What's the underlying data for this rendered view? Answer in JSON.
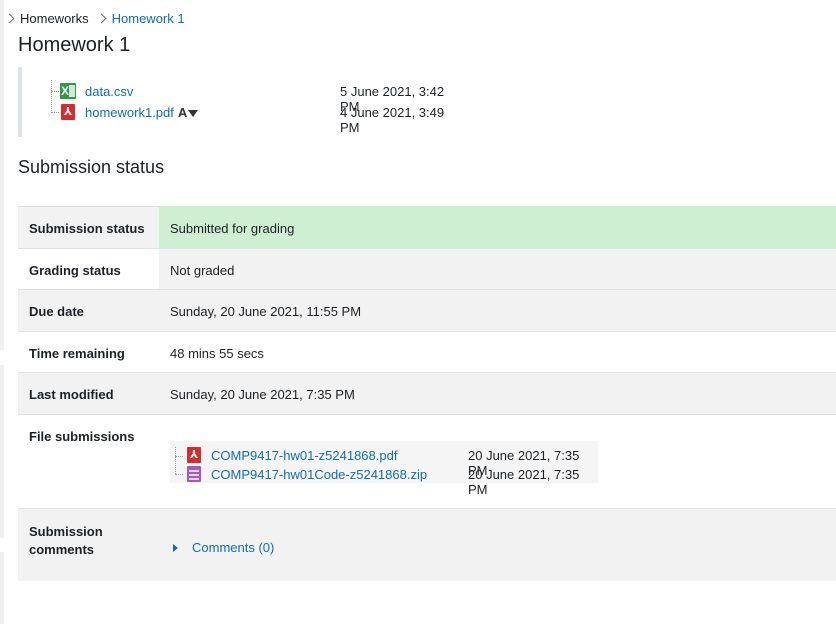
{
  "breadcrumb": {
    "items": [
      {
        "label": "Homeworks"
      },
      {
        "label": "Homework 1"
      }
    ]
  },
  "page": {
    "title": "Homework 1"
  },
  "intro_files": [
    {
      "name": "data.csv",
      "date": "5 June 2021, 3:42 PM",
      "icon": "csv-file-icon"
    },
    {
      "name": "homework1.pdf",
      "date": "4 June 2021, 3:49 PM",
      "icon": "pdf-file-icon",
      "a11y_letter": "A"
    }
  ],
  "submission": {
    "heading": "Submission status",
    "rows": [
      {
        "label": "Submission status",
        "value": "Submitted for grading",
        "status_color": "#cfefd3"
      },
      {
        "label": "Grading status",
        "value": "Not graded"
      },
      {
        "label": "Due date",
        "value": "Sunday, 20 June 2021, 11:55 PM"
      },
      {
        "label": "Time remaining",
        "value": "48 mins 55 secs"
      },
      {
        "label": "Last modified",
        "value": "Sunday, 20 June 2021, 7:35 PM"
      },
      {
        "label": "File submissions"
      },
      {
        "label": "Submission comments"
      }
    ],
    "files": [
      {
        "name": "COMP9417-hw01-z5241868.pdf",
        "date": "20 June 2021, 7:35 PM",
        "icon": "pdf-file-icon"
      },
      {
        "name": "COMP9417-hw01Code-z5241868.zip",
        "date": "20 June 2021, 7:35 PM",
        "icon": "zip-file-icon"
      }
    ],
    "comments_label": "Comments (0)"
  },
  "colors": {
    "link": "#0f6cbf",
    "submitted_green": "#cfefd3",
    "row_grey": "#f2f2f2"
  }
}
